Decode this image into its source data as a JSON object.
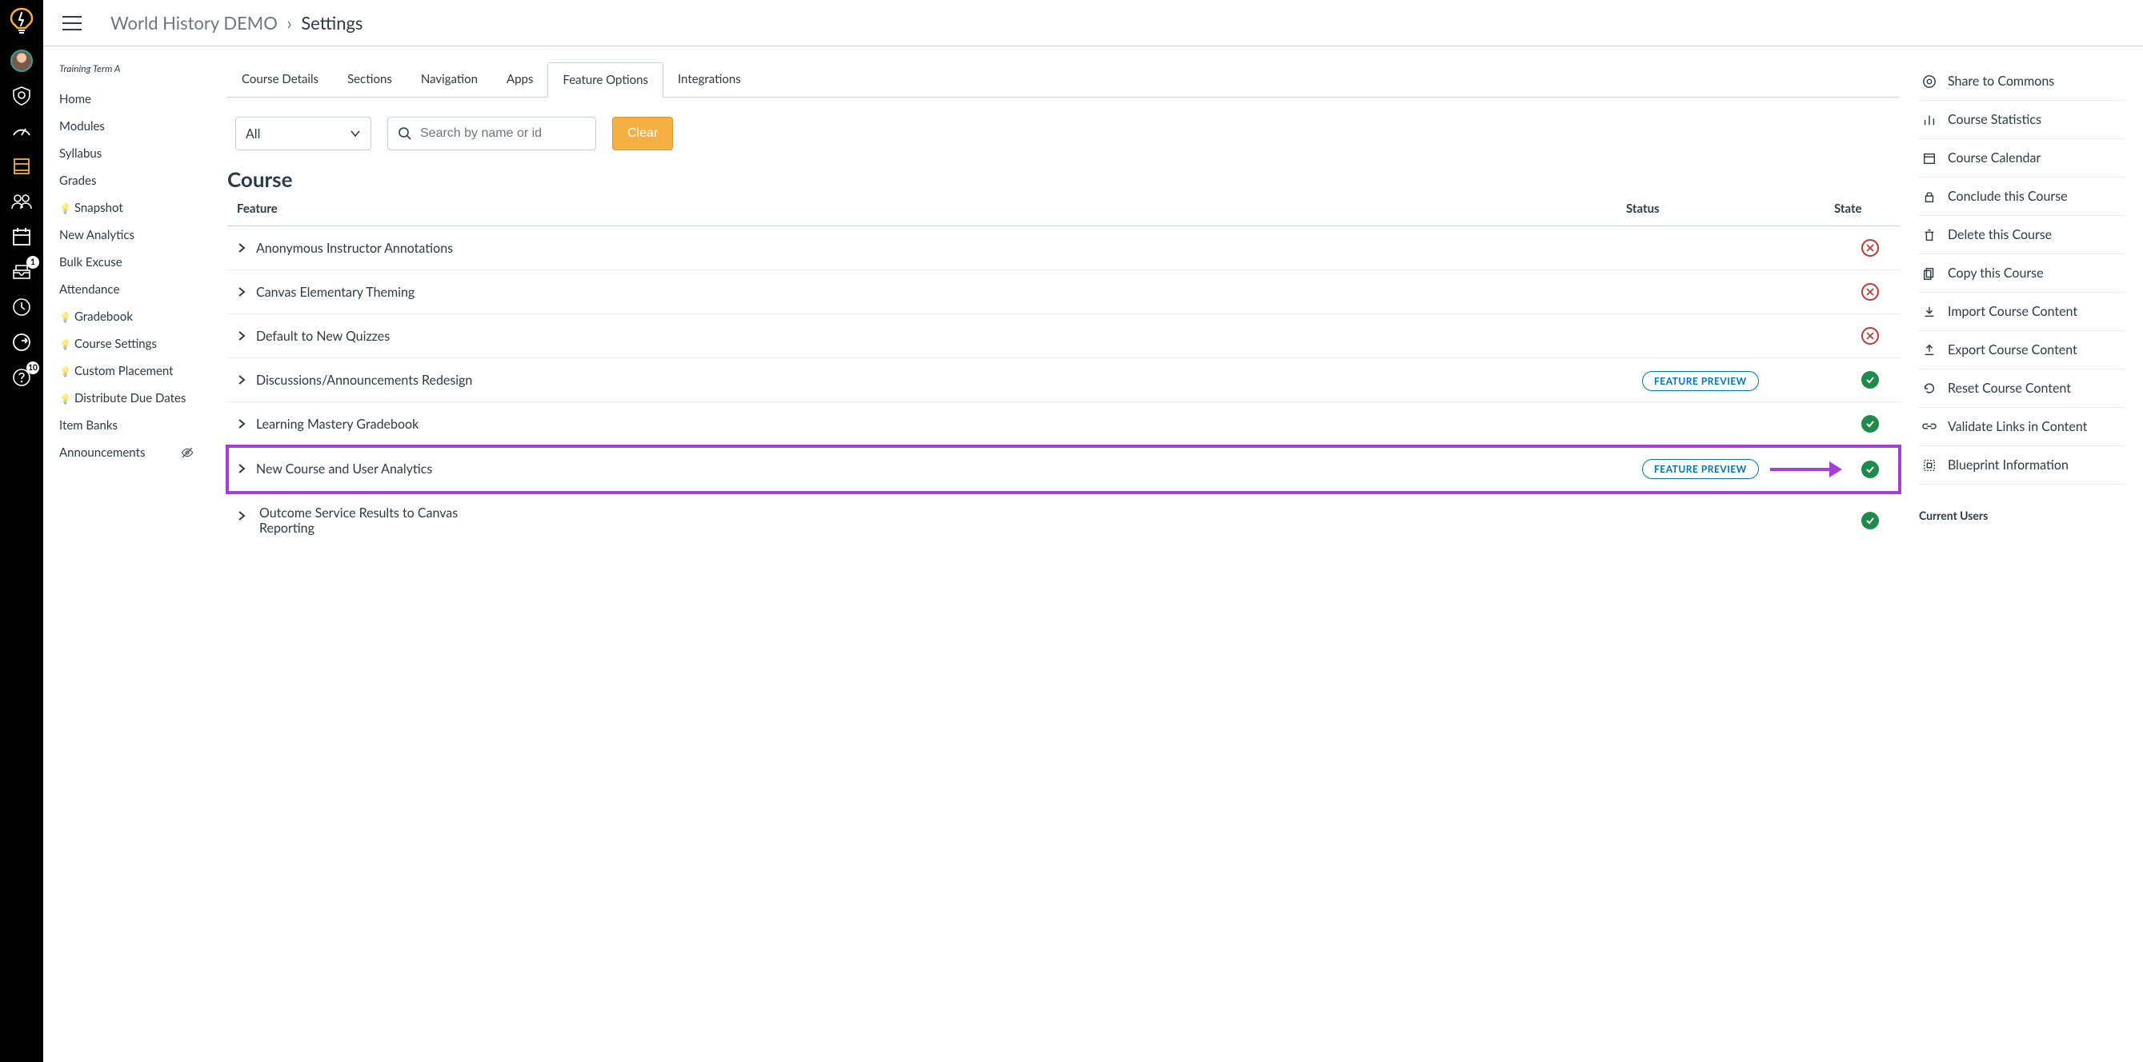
{
  "breadcrumb": {
    "course": "World History DEMO",
    "current": "Settings"
  },
  "term_label": "Training Term A",
  "course_nav": {
    "items": [
      {
        "label": "Home"
      },
      {
        "label": "Modules"
      },
      {
        "label": "Syllabus"
      },
      {
        "label": "Grades"
      },
      {
        "label": "Snapshot",
        "bulb": true
      },
      {
        "label": "New Analytics"
      },
      {
        "label": "Bulk Excuse"
      },
      {
        "label": "Attendance"
      },
      {
        "label": " Gradebook",
        "bulb": true
      },
      {
        "label": "Course Settings",
        "bulb": true
      },
      {
        "label": "Custom Placement",
        "bulb": true
      },
      {
        "label": "Distribute Due Dates",
        "bulb": true
      },
      {
        "label": "Item Banks"
      },
      {
        "label": "Announcements",
        "hidden": true
      }
    ]
  },
  "tabs": {
    "t0": "Course Details",
    "t1": "Sections",
    "t2": "Navigation",
    "t3": "Apps",
    "t4": "Feature Options",
    "t5": "Integrations"
  },
  "filter": {
    "select_value": "All",
    "search_placeholder": "Search by name or id",
    "clear_label": "Clear"
  },
  "section_title": "Course",
  "table": {
    "h_feature": "Feature",
    "h_status": "Status",
    "h_state": "State",
    "preview_badge": "FEATURE PREVIEW",
    "rows": [
      {
        "name": "Anonymous Instructor Annotations",
        "preview": false,
        "state": "off"
      },
      {
        "name": "Canvas Elementary Theming",
        "preview": false,
        "state": "off"
      },
      {
        "name": "Default to New Quizzes",
        "preview": false,
        "state": "off"
      },
      {
        "name": "Discussions/Announcements Redesign",
        "preview": true,
        "state": "on"
      },
      {
        "name": "Learning Mastery Gradebook",
        "preview": false,
        "state": "on"
      },
      {
        "name": "New Course and User Analytics",
        "preview": true,
        "state": "on",
        "highlight": true
      },
      {
        "name": "Outcome Service Results to Canvas Reporting",
        "preview": false,
        "state": "on"
      }
    ]
  },
  "right_panel": {
    "items": {
      "share": "Share to Commons",
      "stats": "Course Statistics",
      "calendar": "Course Calendar",
      "conclude": "Conclude this Course",
      "delete": "Delete this Course",
      "copy": "Copy this Course",
      "import": "Import Course Content",
      "export": "Export Course Content",
      "reset": "Reset Course Content",
      "validate": "Validate Links in Content",
      "blueprint": "Blueprint Information"
    },
    "current_users_head": "Current Users"
  },
  "global_nav_badges": {
    "inbox": "1",
    "help": "10"
  }
}
